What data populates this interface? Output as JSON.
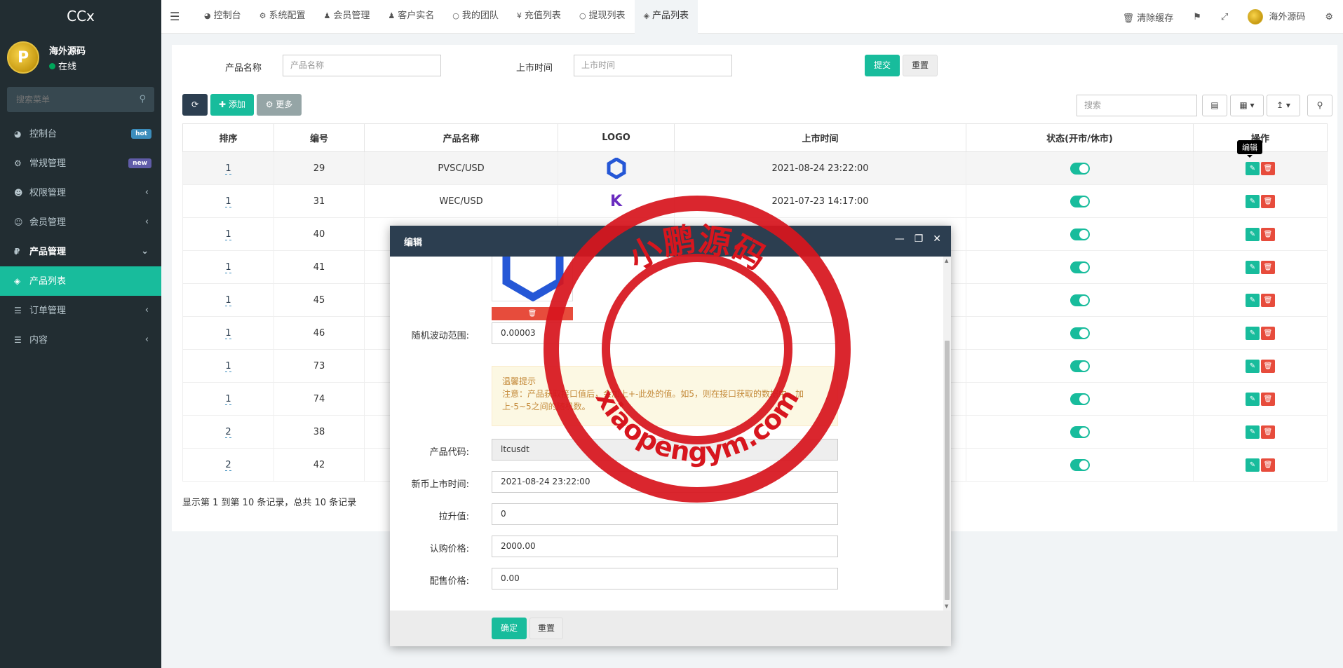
{
  "sidebar": {
    "brand": "CCx",
    "user": {
      "name": "海外源码",
      "status": "在线"
    },
    "search_placeholder": "搜索菜单",
    "menu": [
      {
        "label": "控制台",
        "icon": "dashboard-icon",
        "badge": "hot"
      },
      {
        "label": "常规管理",
        "icon": "cogs-icon",
        "badge": "new"
      },
      {
        "label": "权限管理",
        "icon": "group-icon"
      },
      {
        "label": "会员管理",
        "icon": "user-circle-icon"
      },
      {
        "label": "产品管理",
        "icon": "rmb-icon"
      },
      {
        "label": "产品列表",
        "icon": "cubes-icon"
      },
      {
        "label": "订单管理",
        "icon": "list-icon"
      },
      {
        "label": "内容",
        "icon": "list-icon"
      }
    ]
  },
  "topbar": {
    "tabs": [
      {
        "label": "控制台",
        "icon": "dashboard-icon"
      },
      {
        "label": "系统配置",
        "icon": "cog-icon"
      },
      {
        "label": "会员管理",
        "icon": "user-icon"
      },
      {
        "label": "客户实名",
        "icon": "user-icon"
      },
      {
        "label": "我的团队",
        "icon": "circle-icon"
      },
      {
        "label": "充值列表",
        "icon": "yen-icon"
      },
      {
        "label": "提现列表",
        "icon": "circle-icon"
      },
      {
        "label": "产品列表",
        "icon": "cubes-icon"
      }
    ],
    "clear_cache": "清除缓存",
    "user_name": "海外源码"
  },
  "filter": {
    "name_label": "产品名称",
    "name_placeholder": "产品名称",
    "date_label": "上市时间",
    "date_placeholder": "上市时间",
    "submit": "提交",
    "reset": "重置"
  },
  "toolbar": {
    "add": "添加",
    "more": "更多",
    "search_placeholder": "搜索"
  },
  "table": {
    "headers": [
      "排序",
      "编号",
      "产品名称",
      "LOGO",
      "上市时间",
      "状态(开市/休市)",
      "操作"
    ],
    "rows": [
      {
        "sort": "1",
        "id": "29",
        "name": "PVSC/USD",
        "logo": "hexagon",
        "date": "2021-08-24 23:22:00"
      },
      {
        "sort": "1",
        "id": "31",
        "name": "WEC/USD",
        "logo": "k",
        "date": "2021-07-23 14:17:00"
      },
      {
        "sort": "1",
        "id": "40",
        "name": "",
        "logo": "",
        "date": ""
      },
      {
        "sort": "1",
        "id": "41",
        "name": "",
        "logo": "",
        "date": ""
      },
      {
        "sort": "1",
        "id": "45",
        "name": "",
        "logo": "",
        "date": ""
      },
      {
        "sort": "1",
        "id": "46",
        "name": "",
        "logo": "",
        "date": ""
      },
      {
        "sort": "1",
        "id": "73",
        "name": "",
        "logo": "",
        "date": ""
      },
      {
        "sort": "1",
        "id": "74",
        "name": "",
        "logo": "",
        "date": ""
      },
      {
        "sort": "2",
        "id": "38",
        "name": "",
        "logo": "",
        "date": ""
      },
      {
        "sort": "2",
        "id": "42",
        "name": "",
        "logo": "",
        "date": ""
      }
    ],
    "summary": "显示第 1 到第 10 条记录，总共 10 条记录",
    "tooltip": "编辑"
  },
  "modal": {
    "title": "编辑",
    "fields": {
      "range_label": "随机波动范围:",
      "range_value": "0.00003",
      "notice_title": "温馨提示",
      "notice_text": "注意：产品获取接口值后，会加上+-此处的值。如5，则在接口获取的数据中，加上-5~5之间的随机数。",
      "code_label": "产品代码:",
      "code_value": "ltcusdt",
      "date_label": "新币上市时间:",
      "date_value": "2021-08-24 23:22:00",
      "lift_label": "拉升值:",
      "lift_value": "0",
      "subscribe_label": "认购价格:",
      "subscribe_value": "2000.00",
      "allot_label": "配售价格:",
      "allot_value": "0.00"
    },
    "confirm": "确定",
    "reset": "重置"
  },
  "watermark": {
    "top_text": "小鹏源码",
    "bottom_text": "xiaopengym.com"
  },
  "colors": {
    "sidebar": "#222d32",
    "accent": "#18bc9c",
    "danger": "#e74c3c",
    "header_dark": "#2c3e50",
    "stamp_red": "#d7161e"
  }
}
